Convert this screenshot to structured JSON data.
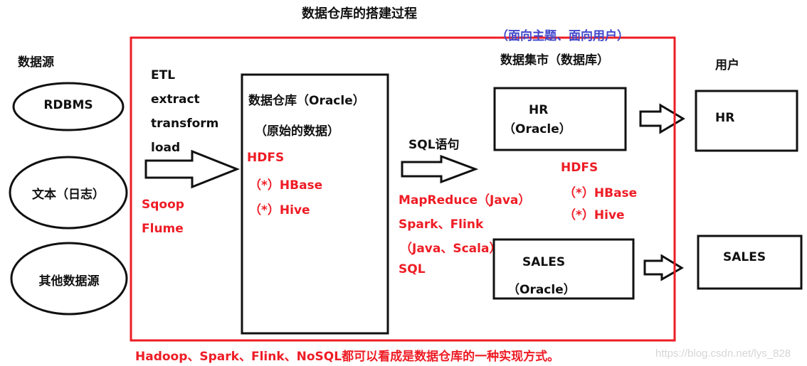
{
  "title": "数据仓库的搭建过程",
  "sources": {
    "heading": "数据源",
    "items": [
      "RDBMS",
      "文本（日志）",
      "其他数据源"
    ]
  },
  "etl": {
    "lines": [
      "ETL",
      "extract",
      "transform",
      "load"
    ],
    "tools": [
      "Sqoop",
      "Flume"
    ]
  },
  "warehouse": {
    "title": "数据仓库（Oracle）",
    "subtitle": "（原始的数据）",
    "tech": [
      "HDFS",
      "（*）HBase",
      "（*）Hive"
    ]
  },
  "processing": {
    "label": "SQL语句",
    "tech": [
      "MapReduce（Java）",
      "Spark、Flink",
      "（Java、Scala）",
      "SQL"
    ]
  },
  "mart": {
    "note": "（面向主题、面向用户）",
    "heading": "数据集市（数据库）",
    "boxes": [
      {
        "name": "HR",
        "sub": "（Oracle）"
      },
      {
        "name": "SALES",
        "sub": "（Oracle）"
      }
    ],
    "tech": [
      "HDFS",
      "（*）HBase",
      "（*）Hive"
    ]
  },
  "users": {
    "heading": "用户",
    "boxes": [
      "HR",
      "SALES"
    ]
  },
  "footer": "Hadoop、Spark、Flink、NoSQL都可以看成是数据仓库的一种实现方式。",
  "watermark": "https://blog.csdn.net/lys_828",
  "colors": {
    "frame": "#ee1c25",
    "text": "#111111",
    "highlight": "#ee1c25",
    "note": "#3f48cc"
  }
}
